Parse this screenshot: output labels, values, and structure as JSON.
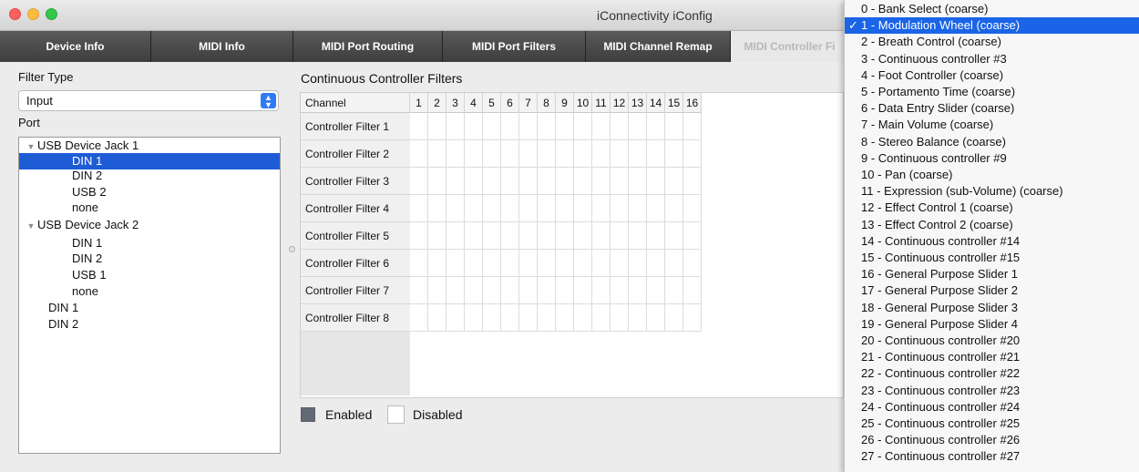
{
  "window": {
    "title": "iConnectivity iConfig"
  },
  "tabs": [
    {
      "label": "Device Info"
    },
    {
      "label": "MIDI Info"
    },
    {
      "label": "MIDI Port Routing"
    },
    {
      "label": "MIDI Port Filters"
    },
    {
      "label": "MIDI Channel Remap"
    },
    {
      "label": "MIDI Controller Fi"
    }
  ],
  "left": {
    "filter_type_label": "Filter Type",
    "filter_type_value": "Input",
    "port_label": "Port",
    "tree": [
      {
        "label": "USB Device Jack 1",
        "expanded": true
      },
      {
        "label": "DIN 1",
        "selected": true
      },
      {
        "label": "DIN 2"
      },
      {
        "label": "USB 2"
      },
      {
        "label": "none"
      },
      {
        "label": "USB Device Jack 2",
        "expanded": true
      },
      {
        "label": "DIN 1"
      },
      {
        "label": "DIN 2"
      },
      {
        "label": "USB 1"
      },
      {
        "label": "none"
      },
      {
        "label": "DIN 1"
      },
      {
        "label": "DIN 2"
      }
    ]
  },
  "filters": {
    "title": "Continuous Controller Filters",
    "channel_header": "Channel",
    "channels": [
      "1",
      "2",
      "3",
      "4",
      "5",
      "6",
      "7",
      "8",
      "9",
      "10",
      "11",
      "12",
      "13",
      "14",
      "15",
      "16"
    ],
    "rows": [
      "Controller Filter 1",
      "Controller Filter 2",
      "Controller Filter 3",
      "Controller Filter 4",
      "Controller Filter 5",
      "Controller Filter 6",
      "Controller Filter 7",
      "Controller Filter 8"
    ],
    "legend_enabled": "Enabled",
    "legend_disabled": "Disabled",
    "enabled_color": "#636a76",
    "disabled_color": "#ffffff"
  },
  "menu": {
    "selected_index": 1,
    "items": [
      "0 - Bank Select (coarse)",
      "1 - Modulation Wheel (coarse)",
      "2 - Breath Control (coarse)",
      "3 - Continuous controller #3",
      "4 - Foot Controller (coarse)",
      "5 - Portamento Time (coarse)",
      "6 - Data Entry Slider (coarse)",
      "7 - Main Volume (coarse)",
      "8 - Stereo Balance (coarse)",
      "9 - Continuous controller #9",
      "10 - Pan (coarse)",
      "11 - Expression (sub-Volume) (coarse)",
      "12 - Effect Control 1 (coarse)",
      "13 - Effect Control 2 (coarse)",
      "14 - Continuous controller #14",
      "15 - Continuous controller #15",
      "16 - General Purpose Slider 1",
      "17 - General Purpose Slider 2",
      "18 - General Purpose Slider 3",
      "19 - General Purpose Slider 4",
      "20 - Continuous controller #20",
      "21 - Continuous controller #21",
      "22 - Continuous controller #22",
      "23 - Continuous controller #23",
      "24 - Continuous controller #24",
      "25 - Continuous controller #25",
      "26 - Continuous controller #26",
      "27 - Continuous controller #27"
    ]
  },
  "colors": {
    "accent": "#1a64e8",
    "tab_bg": "#4a4a4a"
  }
}
